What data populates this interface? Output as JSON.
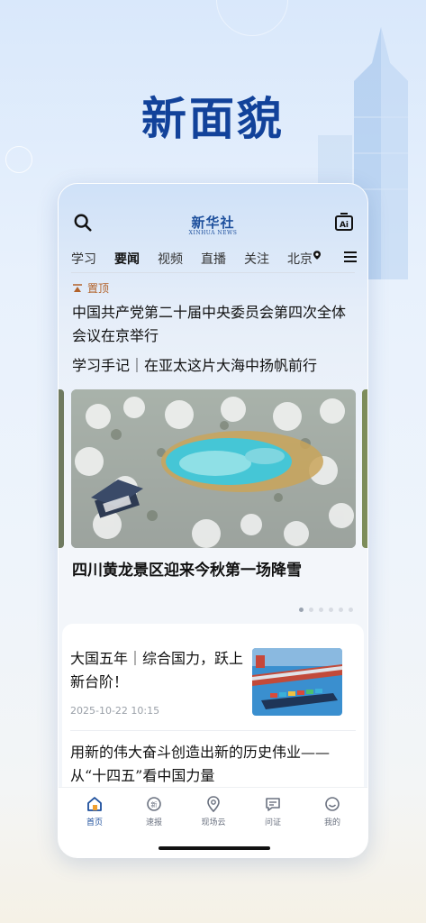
{
  "hero": {
    "headline": "新面貌"
  },
  "app": {
    "logo_cn": "新华社",
    "logo_en": "XINHUA NEWS",
    "icons": {
      "search": "search-icon",
      "ai": "ai-icon",
      "menu": "menu-icon"
    }
  },
  "tabs": [
    {
      "label": "学习"
    },
    {
      "label": "要闻",
      "active": true
    },
    {
      "label": "视频"
    },
    {
      "label": "直播"
    },
    {
      "label": "关注"
    },
    {
      "label": "北京"
    }
  ],
  "feed": {
    "pinned_label": "置顶",
    "top_title": "中国共产党第二十届中央委员会第四次全体会议在京举行",
    "sub_title": "学习手记｜在亚太这片大海中扬帆前行",
    "carousel_caption": "四川黄龙景区迎来今秋第一场降雪",
    "carousel_dots": 6,
    "news": [
      {
        "title": "大国五年｜综合国力，跃上新台阶！",
        "date": "2025-10-22 10:15"
      },
      {
        "title": "用新的伟大奋斗创造出新的历史伟业——从“十四五”看中国力量"
      }
    ]
  },
  "bottom_nav": [
    {
      "label": "首页",
      "icon": "home-icon",
      "active": true
    },
    {
      "label": "速报",
      "icon": "express-icon"
    },
    {
      "label": "现场云",
      "icon": "location-cloud-icon"
    },
    {
      "label": "问证",
      "icon": "question-icon"
    },
    {
      "label": "我的",
      "icon": "profile-icon"
    }
  ],
  "colors": {
    "brand": "#1d4f9c",
    "headline": "#12429a",
    "pinned": "#b2622a"
  }
}
